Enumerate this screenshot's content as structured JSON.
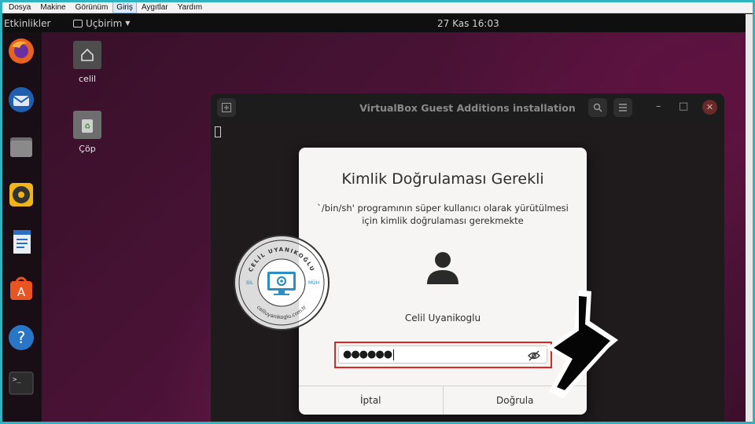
{
  "host_menu": {
    "items": [
      {
        "label": "Dosya"
      },
      {
        "label": "Makine"
      },
      {
        "label": "Görünüm"
      },
      {
        "label": "Giriş"
      },
      {
        "label": "Aygıtlar"
      },
      {
        "label": "Yardım"
      }
    ],
    "active_index": 3
  },
  "topbar": {
    "activities": "Etkinlikler",
    "app_menu": "Uçbirim",
    "clock": "27 Kas  16:03"
  },
  "dock": {
    "items": [
      {
        "name": "firefox-icon"
      },
      {
        "name": "thunderbird-icon"
      },
      {
        "name": "files-icon"
      },
      {
        "name": "rhythmbox-icon"
      },
      {
        "name": "libreoffice-writer-icon"
      },
      {
        "name": "app-center-icon"
      },
      {
        "name": "help-icon"
      },
      {
        "name": "terminal-icon"
      }
    ]
  },
  "desktop": {
    "home_label": "celil",
    "trash_label": "Çöp"
  },
  "terminal_window": {
    "title": "VirtualBox Guest Additions installation"
  },
  "auth_dialog": {
    "title": "Kimlik Doğrulaması Gerekli",
    "message": "`/bin/sh' programının süper kullanıcı olarak yürütülmesi için kimlik doğrulaması gerekmekte",
    "user_name": "Celil Uyanikoglu",
    "password_mask": "●●●●●●",
    "cancel_label": "İptal",
    "confirm_label": "Doğrula"
  },
  "watermark": {
    "top_text": "CELİL UYANIKOĞLU",
    "bottom_text": "celiluyanikoglu.com.tr",
    "left_text": "BİL",
    "right_text": "MÜH"
  },
  "colors": {
    "frame": "#30b3c0",
    "highlight": "#e1241e",
    "seal_accent": "#2a8fc2"
  }
}
